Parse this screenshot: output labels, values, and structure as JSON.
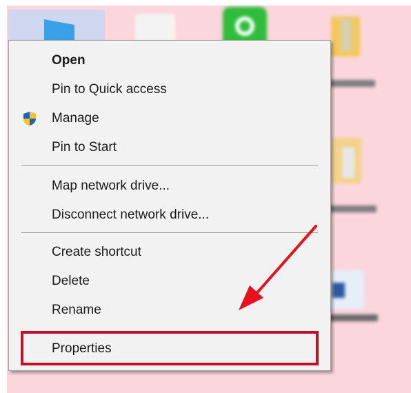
{
  "context_menu": {
    "items": [
      {
        "label": "Open"
      },
      {
        "label": "Pin to Quick access"
      },
      {
        "label": "Manage",
        "icon": "uac-shield-icon"
      },
      {
        "label": "Pin to Start"
      },
      {
        "label": "Map network drive..."
      },
      {
        "label": "Disconnect network drive..."
      },
      {
        "label": "Create shortcut"
      },
      {
        "label": "Delete"
      },
      {
        "label": "Rename"
      },
      {
        "label": "Properties"
      }
    ]
  },
  "annotation": {
    "highlight_color": "#c0102a",
    "arrow_color": "#e8101a"
  },
  "colors": {
    "desktop_background": "#fbd6dc",
    "menu_background": "#f2f2f2",
    "selection": "#cfd7ee"
  }
}
